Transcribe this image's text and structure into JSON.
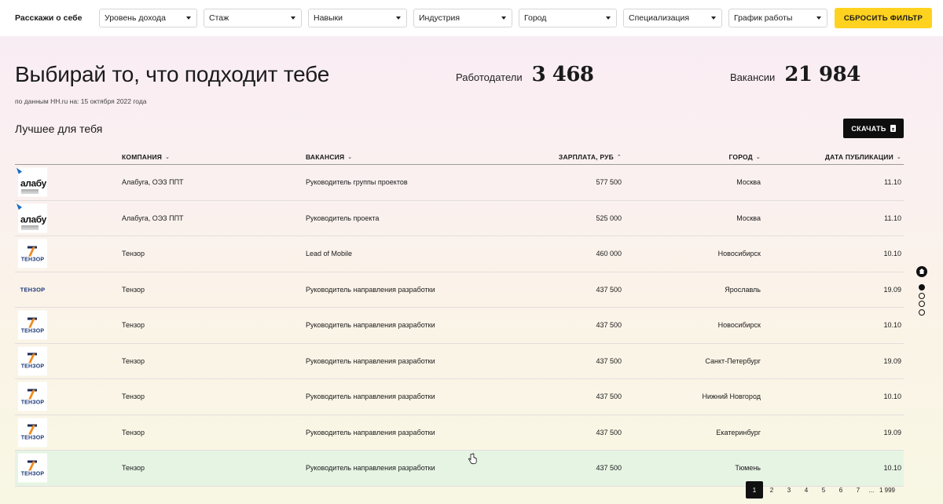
{
  "topbar": {
    "intro": "Расскажи о себе",
    "filters": [
      {
        "label": "Уровень дохода"
      },
      {
        "label": "Стаж"
      },
      {
        "label": "Навыки"
      },
      {
        "label": "Индустрия"
      },
      {
        "label": "Город"
      },
      {
        "label": "Специализация"
      },
      {
        "label": "График работы"
      }
    ],
    "reset_label": "СБРОСИТЬ ФИЛЬТР"
  },
  "hero": {
    "headline": "Выбирай то, что подходит тебе",
    "source": "по данным HH.ru на: 15 октября 2022 года",
    "employers_label": "Работодатели",
    "employers_value": "3 468",
    "vacancies_label": "Вакансии",
    "vacancies_value": "21 984"
  },
  "best": {
    "title": "Лучшее для тебя",
    "download_label": "СКАЧАТЬ"
  },
  "table": {
    "headers": {
      "company": "КОМПАНИЯ",
      "vacancy": "ВАКАНСИЯ",
      "salary": "ЗАРПЛАТА, РУБ",
      "city": "ГОРОД",
      "date": "ДАТА ПУБЛИКАЦИИ"
    },
    "rows": [
      {
        "logo": "alabuga",
        "company": "Алабуга, ОЭЗ ППТ",
        "vacancy": "Руководитель группы проектов",
        "salary": "577 500",
        "city": "Москва",
        "date": "11.10"
      },
      {
        "logo": "alabuga",
        "company": "Алабуга, ОЭЗ ППТ",
        "vacancy": "Руководитель проекта",
        "salary": "525 000",
        "city": "Москва",
        "date": "11.10"
      },
      {
        "logo": "tensor",
        "company": "Тензор",
        "vacancy": "Lead of Mobile",
        "salary": "460 000",
        "city": "Новосибирск",
        "date": "10.10"
      },
      {
        "logo": "tensor-text",
        "company": "Тензор",
        "vacancy": "Руководитель направления разработки",
        "salary": "437 500",
        "city": "Ярославль",
        "date": "19.09"
      },
      {
        "logo": "tensor",
        "company": "Тензор",
        "vacancy": "Руководитель направления разработки",
        "salary": "437 500",
        "city": "Новосибирск",
        "date": "10.10"
      },
      {
        "logo": "tensor",
        "company": "Тензор",
        "vacancy": "Руководитель направления разработки",
        "salary": "437 500",
        "city": "Санкт-Петербург",
        "date": "19.09"
      },
      {
        "logo": "tensor",
        "company": "Тензор",
        "vacancy": "Руководитель направления разработки",
        "salary": "437 500",
        "city": "Нижний Новгород",
        "date": "10.10"
      },
      {
        "logo": "tensor",
        "company": "Тензор",
        "vacancy": "Руководитель направления разработки",
        "salary": "437 500",
        "city": "Екатеринбург",
        "date": "19.09"
      },
      {
        "logo": "tensor",
        "company": "Тензор",
        "vacancy": "Руководитель направления разработки",
        "salary": "437 500",
        "city": "Тюмень",
        "date": "10.10",
        "highlighted": true
      }
    ],
    "logo_text": {
      "alabuga": "алабу",
      "tensor": "ТЕНЗОР"
    }
  },
  "pagination": {
    "pages": [
      "1",
      "2",
      "3",
      "4",
      "5",
      "6",
      "7"
    ],
    "ellipsis": "...",
    "last": "1 999",
    "current": "1"
  },
  "colors": {
    "accent_yellow": "#ffd21f",
    "dark": "#0e0e0e",
    "highlight_row": "#e6f4e4"
  }
}
